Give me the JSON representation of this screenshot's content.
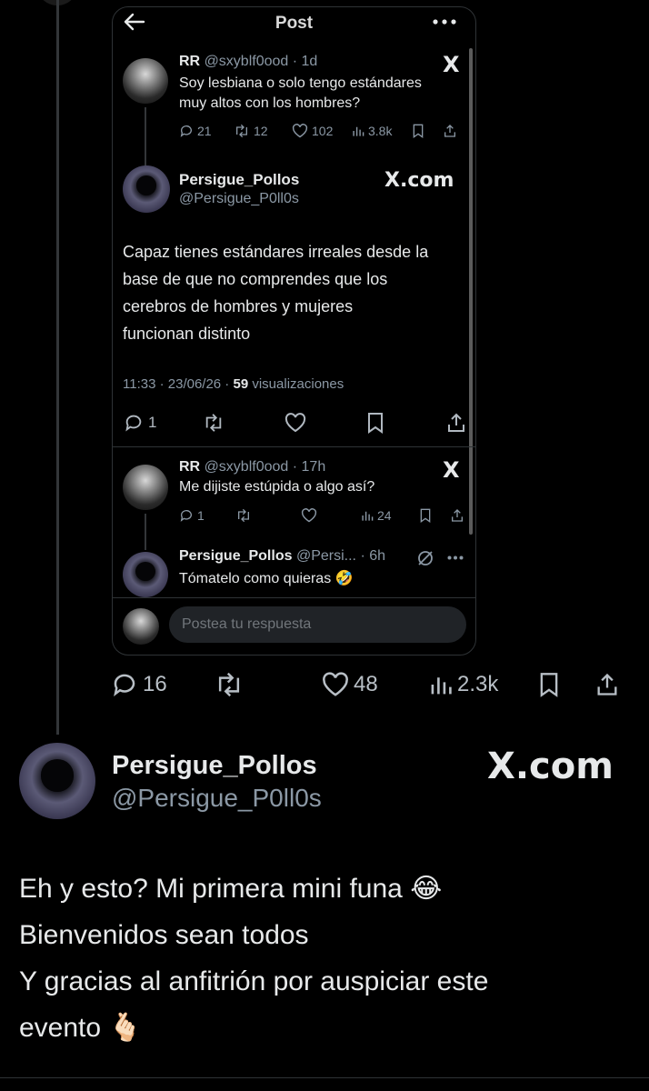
{
  "embedded": {
    "header": {
      "title": "Post",
      "back_icon": "back-arrow-icon",
      "more_icon": "more-dots-icon"
    },
    "quoted_tweet": {
      "name": "RR",
      "handle": "@sxyblf0ood",
      "time": "· 1d",
      "text_line1": "Soy lesbiana o solo tengo estándares",
      "text_line2": "muy altos con los hombres?",
      "replies": "21",
      "reposts": "12",
      "likes": "102",
      "views": "3.8k",
      "x_logo": "X"
    },
    "main_tweet": {
      "name": "Persigue_Pollos",
      "handle": "@Persigue_P0ll0s",
      "x_logo": "X.com",
      "lines": [
        "Capaz tienes estándares irreales desde la",
        "base de que no comprendes que los",
        "cerebros de hombres y mujeres",
        "funcionan distinto"
      ],
      "meta_time": "11:33 · 23/06/26 · ",
      "meta_views": "59",
      "meta_views_label": " visualizaciones",
      "replies": "1"
    },
    "reply1": {
      "name": "RR",
      "handle": "@sxyblf0ood",
      "time": "· 17h",
      "text": "Me dijiste estúpida o algo así?",
      "replies": "1",
      "views": "24",
      "x_logo": "X"
    },
    "reply2": {
      "name": "Persigue_Pollos",
      "handle": "@Persi...",
      "time": "· 6h",
      "text": "Tómatelo como quieras",
      "emoji": "🤣"
    },
    "reply_box": {
      "placeholder": "Postea tu respuesta"
    }
  },
  "outer_actions": {
    "replies": "16",
    "likes": "48",
    "views": "2.3k"
  },
  "outer_post": {
    "name": "Persigue_Pollos",
    "handle": "@Persigue_P0ll0s",
    "x_logo": "X.com",
    "line1": "Eh y esto? Mi primera mini funa",
    "line1_emoji": "😂",
    "line2": "Bienvenidos sean todos",
    "line3": "Y gracias al anfitrión por auspiciar este",
    "line4": "evento",
    "line4_emoji": "🫰🏻"
  },
  "colors": {
    "background": "#000000",
    "text": "#e7e9ea",
    "muted": "#8b98a5",
    "border": "#2f3336"
  }
}
